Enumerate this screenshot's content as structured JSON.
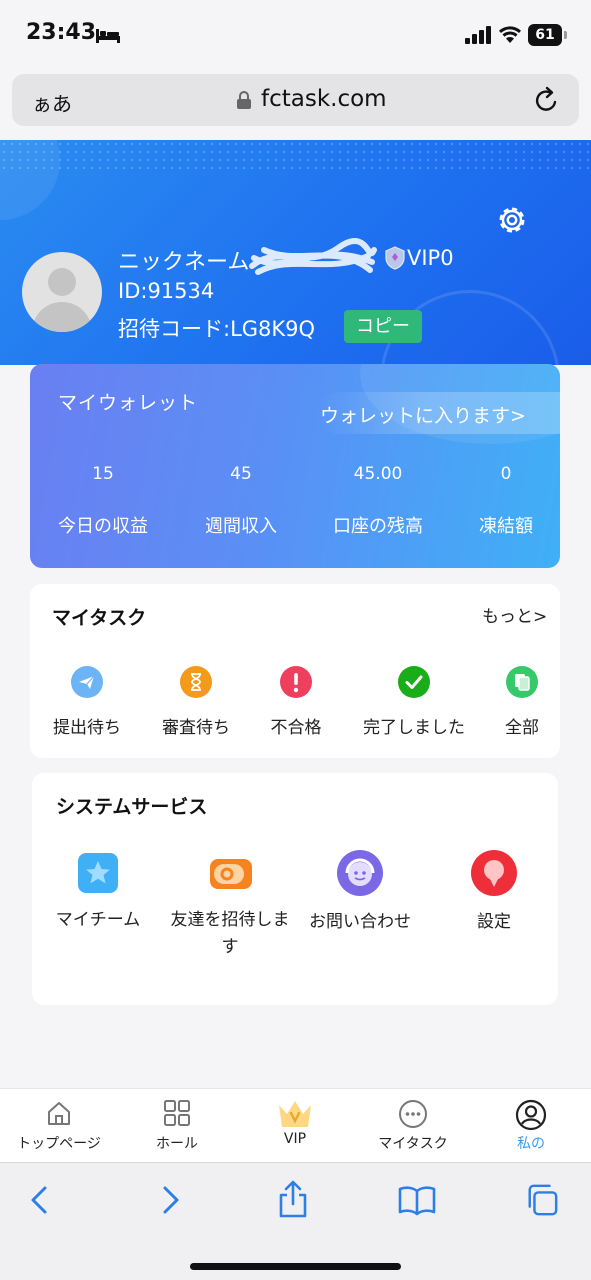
{
  "status_bar": {
    "time": "23:43",
    "battery": "61"
  },
  "browser": {
    "text_size_label": "ぁあ",
    "url": "fctask.com"
  },
  "profile": {
    "nickname_label": "ニックネーム",
    "vip_level": "VIP0",
    "user_id": "ID:91534",
    "invite_code": "招待コード:LG8K9Q",
    "copy_button": "コピー"
  },
  "wallet": {
    "title": "マイウォレット",
    "enter_link": "ウォレットに入ります>",
    "stats": [
      {
        "value": "15",
        "label": "今日の収益"
      },
      {
        "value": "45",
        "label": "週間収入"
      },
      {
        "value": "45.00",
        "label": "口座の残高"
      },
      {
        "value": "0",
        "label": "凍結額"
      }
    ]
  },
  "tasks": {
    "title": "マイタスク",
    "more": "もっと>",
    "items": [
      {
        "label": "提出待ち",
        "icon": "send-icon",
        "color": "#6cb4f5"
      },
      {
        "label": "審査待ち",
        "icon": "hourglass-icon",
        "color": "#f39a1a"
      },
      {
        "label": "不合格",
        "icon": "exclamation-icon",
        "color": "#ee3f5e"
      },
      {
        "label": "完了しました",
        "icon": "check-icon",
        "color": "#1aad19"
      },
      {
        "label": "全部",
        "icon": "documents-icon",
        "color": "#36c96a"
      }
    ]
  },
  "services": {
    "title": "システムサービス",
    "items": [
      {
        "label": "マイチーム",
        "icon": "team-star-icon",
        "color": "#3fb0f5"
      },
      {
        "label": "友達を招待しま\nす",
        "icon": "wallet-icon",
        "color": "#f5831f"
      },
      {
        "label": "お問い合わせ",
        "icon": "support-icon",
        "color": "#7b68e6"
      },
      {
        "label": "設定",
        "icon": "settings-balloon-icon",
        "color": "#ee2f3a"
      }
    ]
  },
  "tabbar": {
    "items": [
      {
        "label": "トップページ",
        "icon": "home-icon"
      },
      {
        "label": "ホール",
        "icon": "grid-icon"
      },
      {
        "label": "VIP",
        "icon": "crown-icon"
      },
      {
        "label": "マイタスク",
        "icon": "more-dots-icon"
      },
      {
        "label": "私の",
        "icon": "profile-icon",
        "active": true
      }
    ],
    "active_color": "#3a9df0"
  }
}
